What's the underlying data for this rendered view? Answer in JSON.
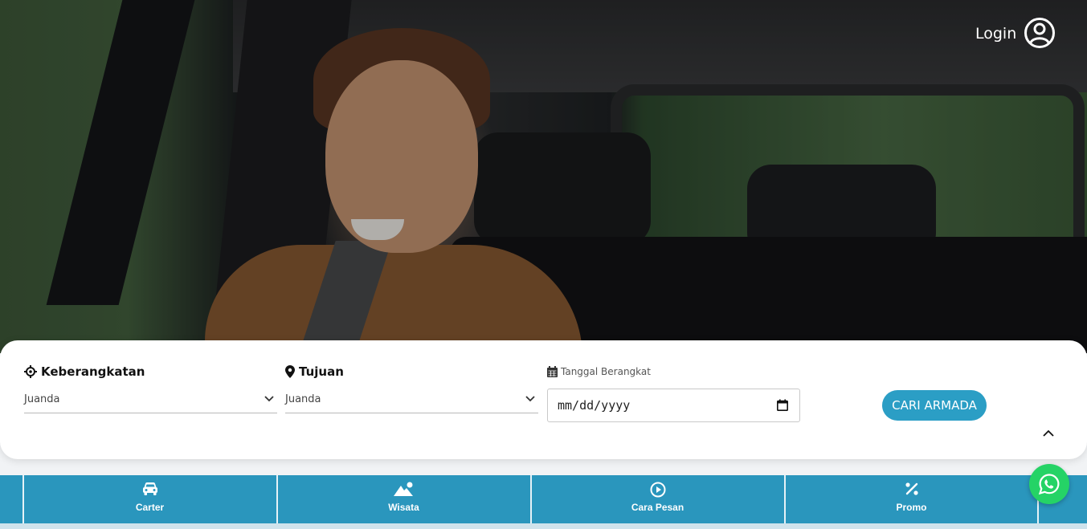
{
  "header": {
    "login_label": "Login"
  },
  "search": {
    "departure": {
      "label": "Keberangkatan",
      "value": "Juanda"
    },
    "destination": {
      "label": "Tujuan",
      "value": "Juanda"
    },
    "date": {
      "label": "Tanggal Berangkat",
      "placeholder": "mm/dd/yyyy"
    },
    "submit_label": "CARI ARMADA"
  },
  "bottom_nav": {
    "items": [
      {
        "label": "Carter",
        "icon": "car-icon"
      },
      {
        "label": "Wisata",
        "icon": "mountain-icon"
      },
      {
        "label": "Cara Pesan",
        "icon": "play-circle-icon"
      },
      {
        "label": "Promo",
        "icon": "percent-icon"
      }
    ]
  },
  "colors": {
    "accent": "#2b9ec5",
    "nav": "#2a96bd",
    "whatsapp": "#25d366"
  }
}
